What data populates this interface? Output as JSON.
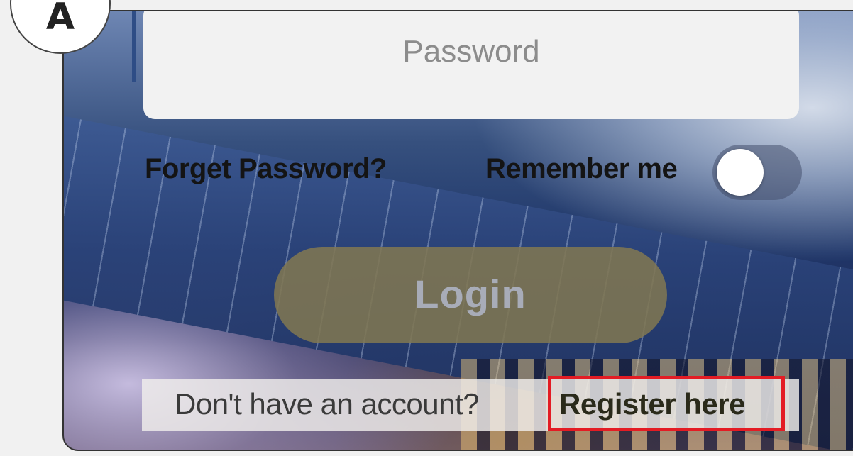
{
  "figure": {
    "panel_label": "A",
    "highlight_color": "#e31c24"
  },
  "login_form": {
    "password_placeholder": "Password",
    "forget_password_label": "Forget Password?",
    "remember_me_label": "Remember me",
    "remember_me_on": false,
    "login_label": "Login",
    "no_account_text": "Don't have an account?",
    "register_label": "Register here"
  },
  "colors": {
    "login_button": "#807652",
    "input_background": "#f2f2f2",
    "toggle_knob": "#ffffff"
  },
  "icons": {
    "toggle": "toggle-switch-icon"
  }
}
